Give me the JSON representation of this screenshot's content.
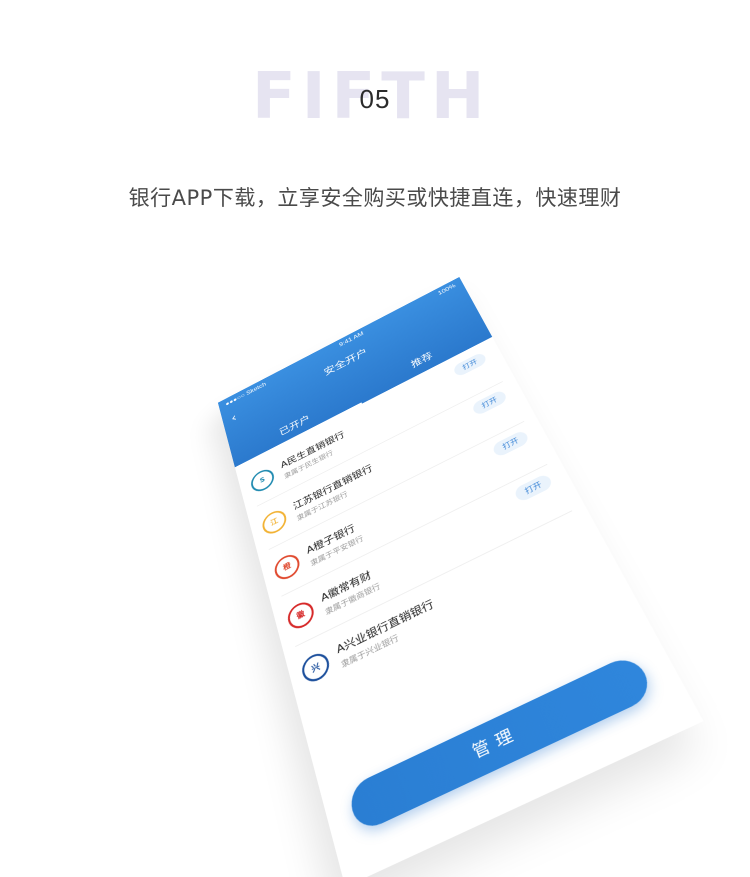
{
  "header": {
    "background_word": "FIFTH",
    "step_number": "05",
    "tagline": "银行APP下载，立享安全购买或快捷直连，快速理财"
  },
  "phone": {
    "status": {
      "carrier": "●●●○○ Sketch",
      "time": "9:41 AM",
      "battery": "100%"
    },
    "nav": {
      "back_icon": "chevron-left-icon",
      "title": "安全开户"
    },
    "tabs": [
      {
        "label": "已开户",
        "active": true
      },
      {
        "label": "推荐",
        "active": false
      }
    ],
    "banks": [
      {
        "name": "A民生直销银行",
        "sub": "隶属于民生银行",
        "action": "打开",
        "logo_color": "#1f8ab0",
        "logo_icon": "minsheng-logo-icon",
        "logo_text": "S"
      },
      {
        "name": "江苏银行直销银行",
        "sub": "隶属于江苏银行",
        "action": "打开",
        "logo_color": "#f2b233",
        "logo_icon": "jiangsu-logo-icon",
        "logo_text": "江"
      },
      {
        "name": "A橙子银行",
        "sub": "隶属于平安银行",
        "action": "打开",
        "logo_color": "#e0492e",
        "logo_icon": "orange-bank-logo-icon",
        "logo_text": "橙"
      },
      {
        "name": "A徽常有财",
        "sub": "隶属于徽商银行",
        "action": "打开",
        "logo_color": "#d62828",
        "logo_icon": "huishang-logo-icon",
        "logo_text": "徽"
      },
      {
        "name": "A兴业银行直销银行",
        "sub": "隶属于兴业银行",
        "action": "",
        "logo_color": "#1c4f9c",
        "logo_icon": "xingye-logo-icon",
        "logo_text": "兴"
      }
    ],
    "manage_label": "管理"
  },
  "colors": {
    "primary": "#2b79cd",
    "accent_light": "#eaf3fc",
    "bg_word": "#e6e4f1"
  }
}
